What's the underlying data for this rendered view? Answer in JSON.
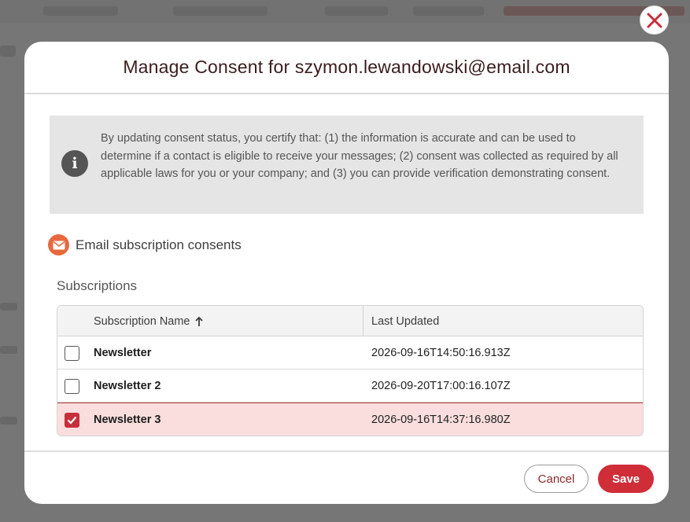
{
  "modal": {
    "title": "Manage Consent for szymon.lewandowski@email.com",
    "close_icon": "close-icon",
    "info": {
      "icon": "info-icon",
      "text": "By updating consent status, you certify that: (1) the information is accurate and can be used to determine if a contact is eligible to receive your messages; (2) consent was collected as required by all applicable laws for you or your company; and (3) you can provide verification demonstrating consent."
    },
    "section": {
      "icon": "mail-icon",
      "label": "Email subscription consents"
    },
    "subscriptions_label": "Subscriptions",
    "table": {
      "columns": [
        "Subscription Name",
        "Last Updated"
      ],
      "sort_icon": "arrow-up-icon",
      "rows": [
        {
          "name": "Newsletter",
          "updated": "2026-09-16T14:50:16.913Z",
          "checked": false
        },
        {
          "name": "Newsletter 2",
          "updated": "2026-09-20T17:00:16.107Z",
          "checked": false
        },
        {
          "name": "Newsletter 3",
          "updated": "2026-09-16T14:37:16.980Z",
          "checked": true
        }
      ]
    },
    "footer": {
      "cancel_label": "Cancel",
      "save_label": "Save"
    }
  },
  "colors": {
    "accent": "#cf2d38",
    "mail_icon": "#e8683e",
    "selected_row": "#f9dedd"
  }
}
